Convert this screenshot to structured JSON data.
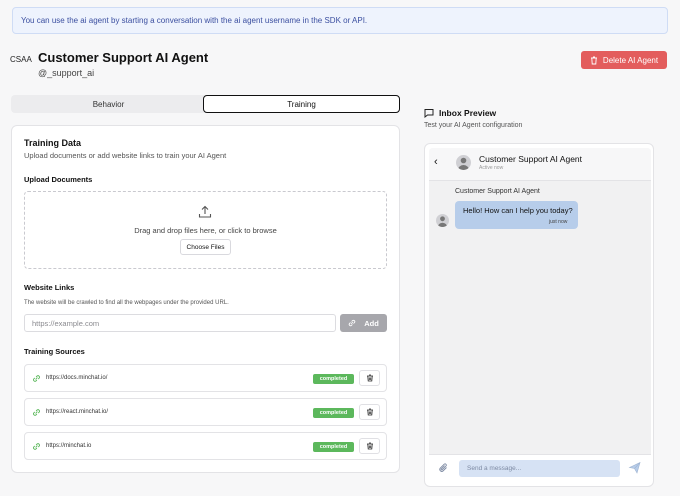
{
  "banner": {
    "text": "You can use the ai agent by starting a conversation with the ai agent username in the SDK or API."
  },
  "header": {
    "avatar_text": "CSAA",
    "title": "Customer Support AI Agent",
    "username": "@_support_ai",
    "delete_label": "Delete AI Agent",
    "delete_icon": "trash-icon"
  },
  "tabs": [
    {
      "label": "Behavior",
      "active": false
    },
    {
      "label": "Training",
      "active": true
    }
  ],
  "training": {
    "title": "Training Data",
    "subtitle": "Upload documents or add website links to train your AI Agent",
    "upload": {
      "title": "Upload Documents",
      "icon": "upload-icon",
      "drop_text": "Drag and drop files here, or click to browse",
      "choose_label": "Choose Files"
    },
    "links": {
      "title": "Website Links",
      "subtitle": "The website will be crawled to find all the webpages under the provided URL.",
      "input_value": "",
      "input_placeholder": "https://example.com",
      "add_label": "Add",
      "add_icon": "link-icon"
    },
    "sources": {
      "title": "Training Sources",
      "items": [
        {
          "url": "https://docs.minchat.io/",
          "status": "completed"
        },
        {
          "url": "https://react.minchat.io/",
          "status": "completed"
        },
        {
          "url": "https://minchat.io",
          "status": "completed"
        }
      ]
    }
  },
  "inbox": {
    "title": "Inbox Preview",
    "subtitle": "Test your AI Agent configuration",
    "chat": {
      "name": "Customer Support AI Agent",
      "status": "Active now",
      "messages": [
        {
          "sender": "Customer Support AI Agent",
          "text": "Hello! How can I help you today?",
          "time": "just now"
        }
      ],
      "composer_value": "",
      "composer_placeholder": "Send a message..."
    }
  },
  "colors": {
    "danger": "#e35d5d",
    "success": "#5cb85c",
    "bubble": "#b7cdea",
    "banner_bg": "#eef3fd",
    "banner_text": "#3b4fa0"
  }
}
